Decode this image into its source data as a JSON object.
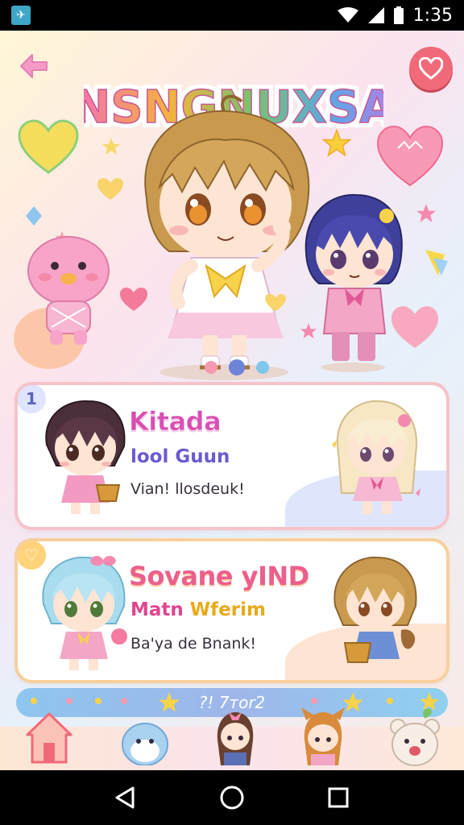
{
  "status_bar": {
    "time": "1:35"
  },
  "header": {
    "logo_text": "NSNGNUXSA"
  },
  "carousel": {
    "pages": 3,
    "active": 2
  },
  "cards": [
    {
      "badge": "1",
      "title": "Kitada",
      "subtitle": "lool Guun",
      "description": "Vian! llosdeuk!"
    },
    {
      "badge": "♡",
      "title": "Sovane yIND",
      "subtitle_part1": "Matn",
      "subtitle_part2": "Wferim",
      "description": "Ba'ya de Bnank!"
    }
  ],
  "strip": {
    "text": "?! 7тor2"
  },
  "tabs": [
    "home-tab",
    "seal-tab",
    "girl-tab",
    "fox-girl-tab",
    "bear-tab"
  ],
  "colors": {
    "accent_pink": "#f06a7a",
    "title_magenta": "#d94fb2",
    "title_coral": "#ec5f8c",
    "sub_purple": "#6a5bd3"
  }
}
